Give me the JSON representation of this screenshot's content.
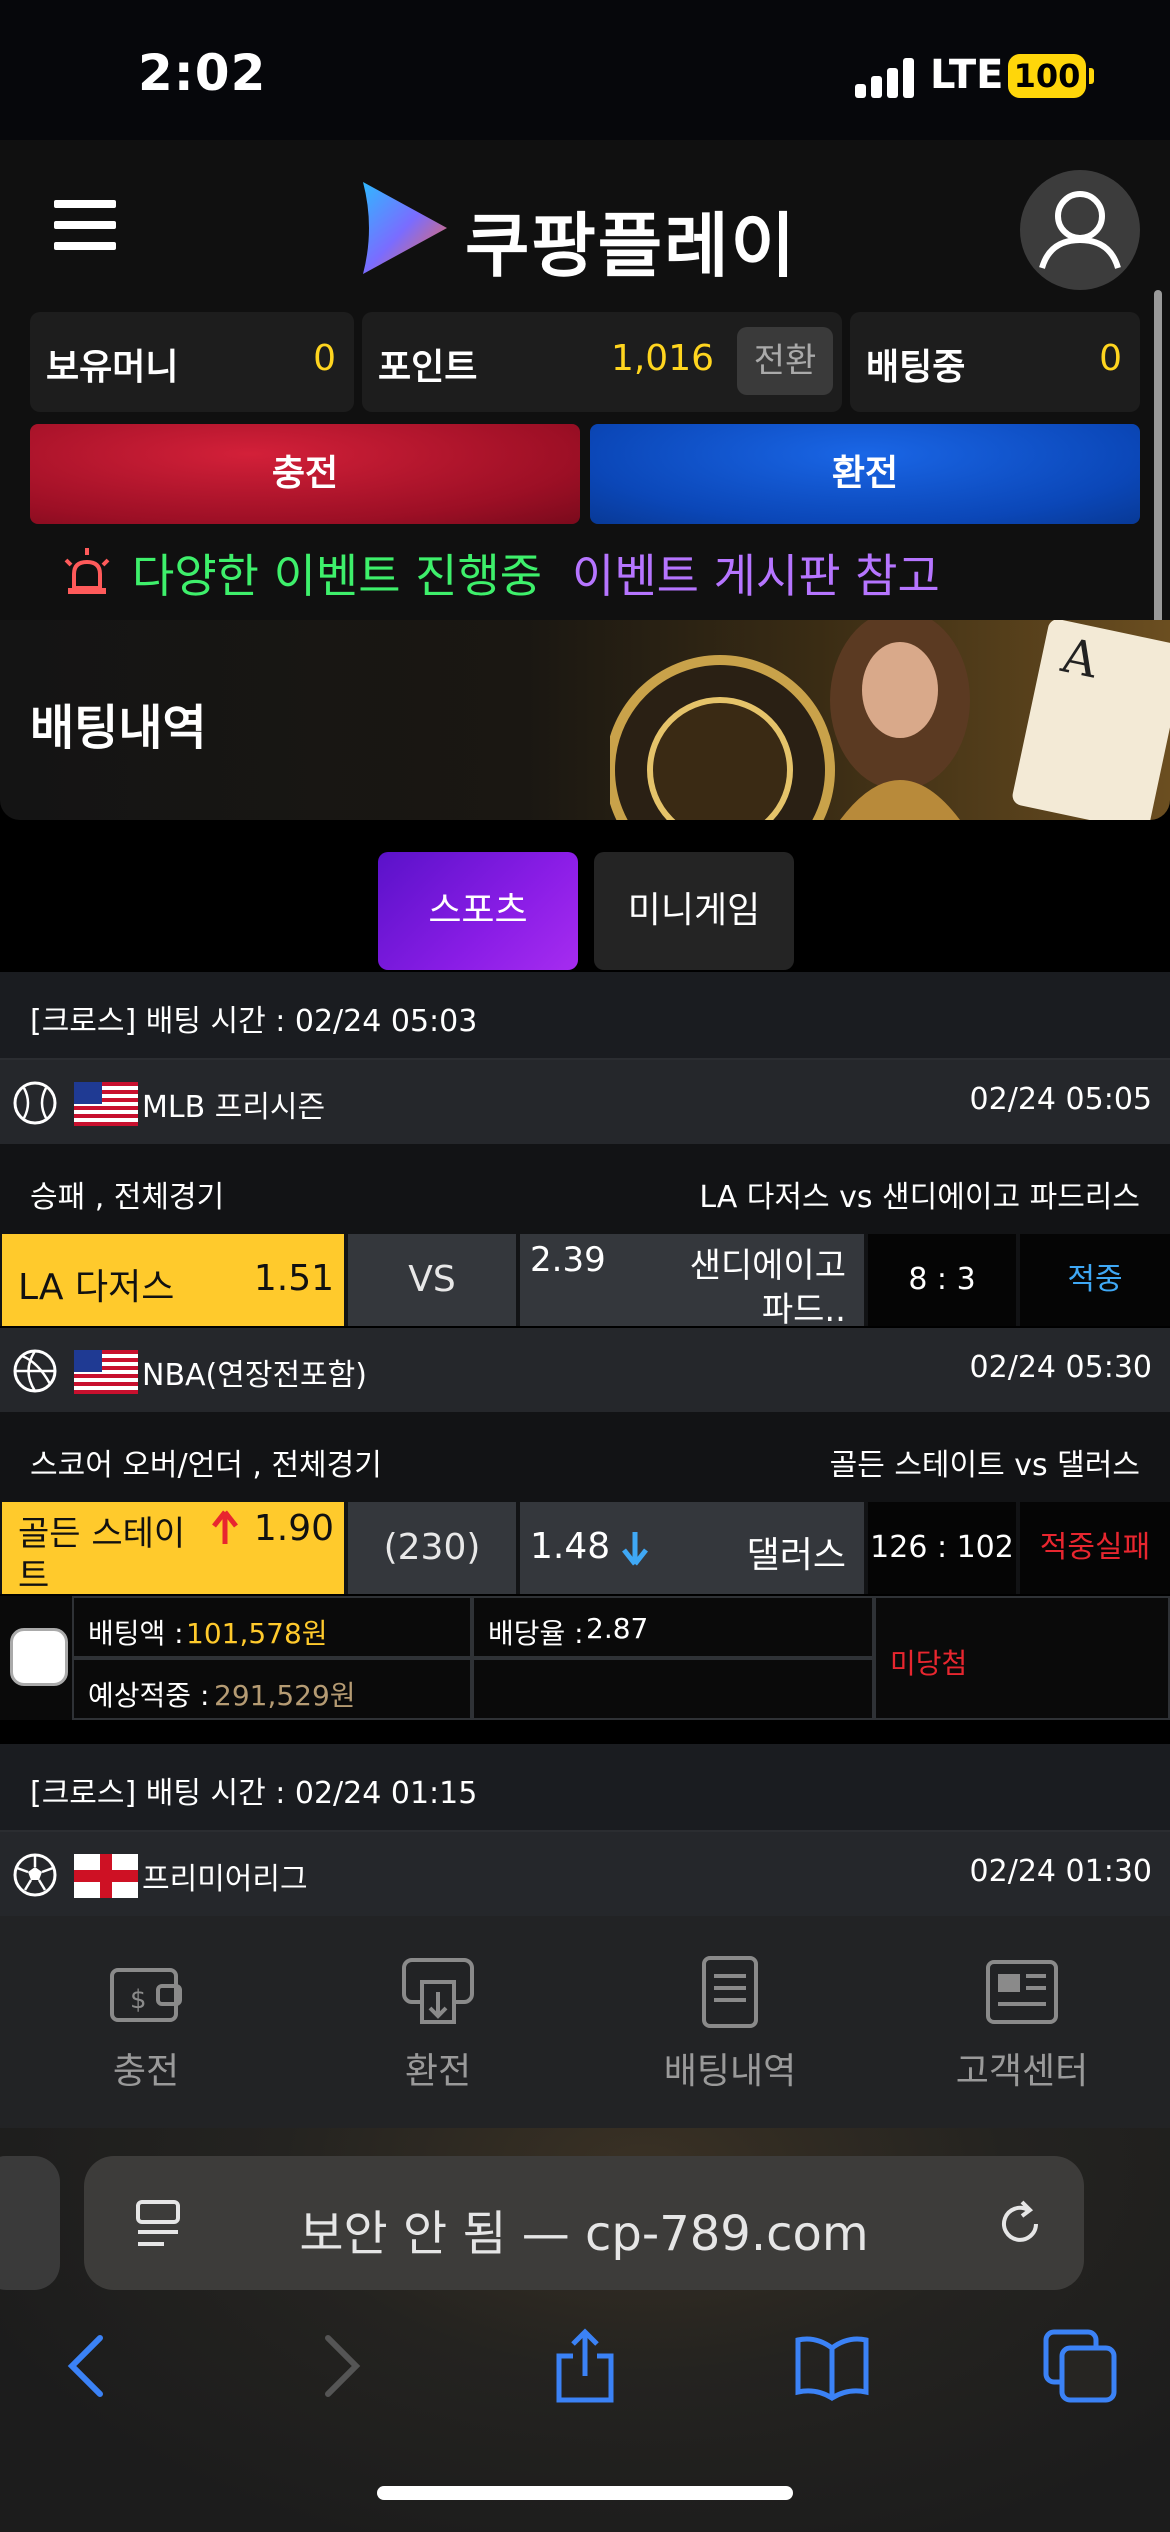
{
  "status": {
    "time": "2:02",
    "network": "LTE",
    "battery": "100"
  },
  "header": {
    "logo_text": "쿠팡플레이"
  },
  "balances": {
    "money_label": "보유머니",
    "money_value": "0",
    "point_label": "포인트",
    "point_value": "1,016",
    "convert_label": "전환",
    "betting_label": "배팅중",
    "betting_value": "0"
  },
  "actions": {
    "charge": "충전",
    "exchange": "환전"
  },
  "notice": {
    "green_text": "다양한 이벤트 진행중",
    "purple_text": "이벤트 게시판 참고"
  },
  "banner": {
    "title": "배팅내역"
  },
  "tabs": [
    {
      "label": "스포츠",
      "active": true
    },
    {
      "label": "미니게임",
      "active": false
    }
  ],
  "bets": [
    {
      "header": "[크로스] 배팅 시간 : 02/24 05:03",
      "games": [
        {
          "league": "MLB 프리시즌",
          "time": "02/24 05:05",
          "market": "승패 , 전체경기",
          "matchup": "LA 다저스  vs  샌디에이고 파드리스",
          "home": "LA 다저스",
          "home_odds": "1.51",
          "middle": "VS",
          "away_odds": "2.39",
          "away_line1": "샌디에이고",
          "away_line2": "파드..",
          "score": "8 : 3",
          "result": "적중"
        },
        {
          "league": "NBA(연장전포함)",
          "time": "02/24 05:30",
          "market": "스코어 오버/언더 , 전체경기",
          "matchup": "골든 스테이트  vs  댈러스",
          "home_line1": "골든 스테이",
          "home_line2": "트",
          "home_odds": "1.90",
          "middle": "(230)",
          "away_odds": "1.48",
          "away": "댈러스",
          "score": "126 : 102",
          "result": "적중실패"
        }
      ],
      "slip": {
        "amount_label": "배팅액 : ",
        "amount": "101,578원",
        "rate_label": "배당율 : ",
        "rate": "2.87",
        "expected_label": "예상적중 : ",
        "expected": "291,529원",
        "status": "미당첨"
      }
    },
    {
      "header": "[크로스] 배팅 시간 : 02/24 01:15",
      "games": [
        {
          "league": "프리미어리그",
          "time": "02/24 01:30"
        }
      ]
    }
  ],
  "bottom_nav": [
    {
      "label": "충전",
      "icon": "wallet-icon"
    },
    {
      "label": "환전",
      "icon": "atm-withdraw-icon"
    },
    {
      "label": "배팅내역",
      "icon": "document-icon"
    },
    {
      "label": "고객센터",
      "icon": "newspaper-icon"
    }
  ],
  "browser": {
    "url_text": "보안 안 됨 — cp-789.com"
  },
  "colors": {
    "accent_yellow": "#ffca2c",
    "win_blue": "#3fa8f5",
    "lose_red": "#e8262f",
    "notice_green": "#3ef06b",
    "notice_purple": "#b675ff"
  }
}
